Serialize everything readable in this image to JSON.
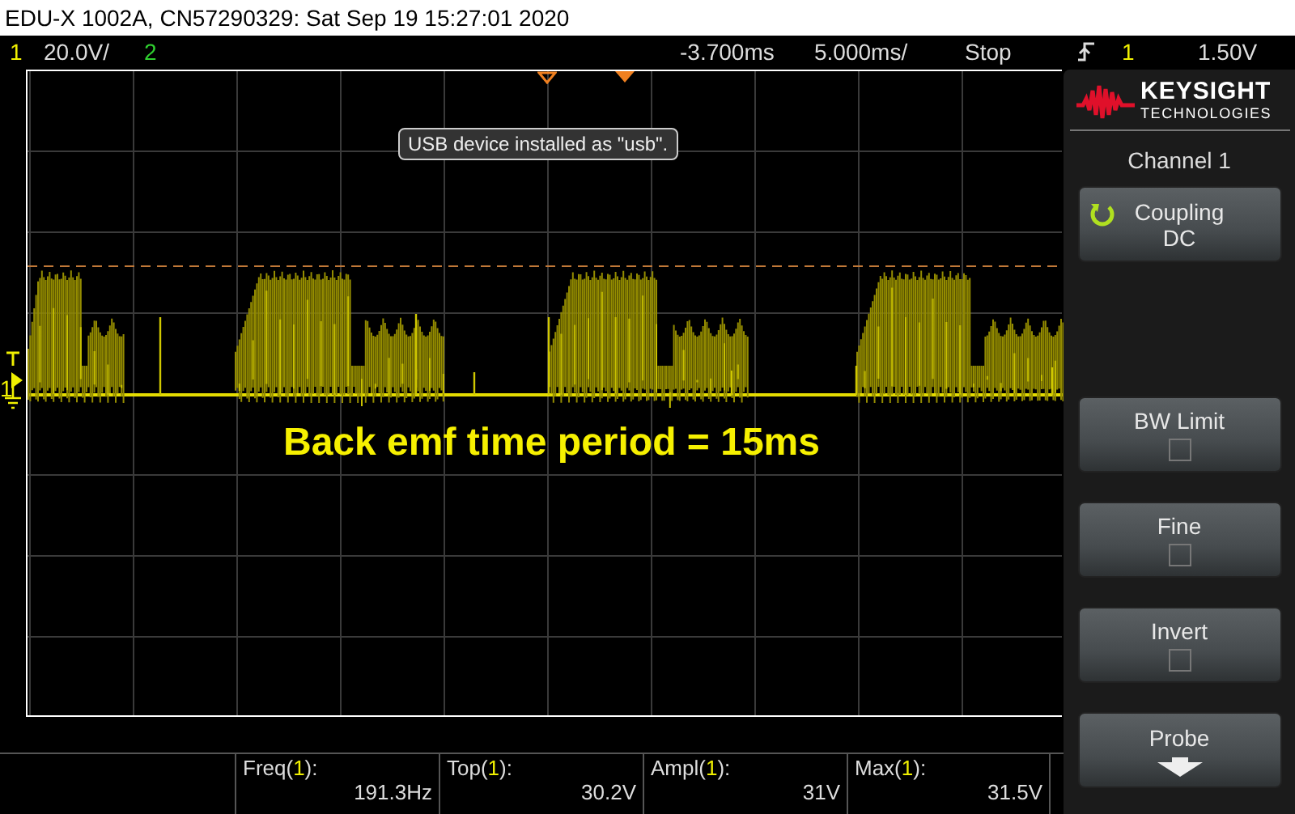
{
  "window": {
    "title": "EDU-X 1002A, CN57290329: Sat Sep 19 15:27:01 2020"
  },
  "status_bar": {
    "channels": [
      {
        "number": "1",
        "color": "#f0f000",
        "scale": "20.0V/"
      },
      {
        "number": "2",
        "color": "#30d030"
      }
    ],
    "horizontal_position": "-3.700ms",
    "time_scale": "5.000ms/",
    "run_state": "Stop",
    "trigger": {
      "source": "1",
      "level": "1.50V"
    }
  },
  "screen": {
    "message": "USB device installed as \"usb\".",
    "annotation": "Back emf time period = 15ms",
    "ground_marker": "1"
  },
  "measurements": [
    {
      "name": "Freq(",
      "channel": "1",
      "suffix": "):",
      "value": "191.3Hz"
    },
    {
      "name": "Top(",
      "channel": "1",
      "suffix": "):",
      "value": "30.2V"
    },
    {
      "name": "Ampl(",
      "channel": "1",
      "suffix": "):",
      "value": "31V"
    },
    {
      "name": "Max(",
      "channel": "1",
      "suffix": "):",
      "value": "31.5V"
    }
  ],
  "panel": {
    "logo": {
      "name": "KEYSIGHT",
      "subtitle": "TECHNOLOGIES"
    },
    "title": "Channel 1",
    "softkeys": [
      {
        "kind": "cycle",
        "label": "Coupling",
        "value": "DC"
      },
      {
        "kind": "checkbox",
        "label": "BW Limit",
        "checked": false
      },
      {
        "kind": "checkbox",
        "label": "Fine",
        "checked": false
      },
      {
        "kind": "checkbox",
        "label": "Invert",
        "checked": false
      },
      {
        "kind": "menu",
        "label": "Probe"
      }
    ]
  }
}
